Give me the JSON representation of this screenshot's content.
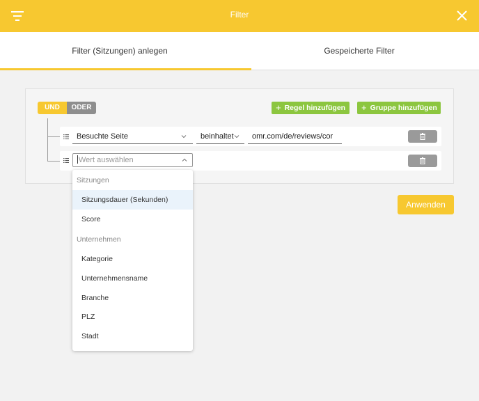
{
  "header": {
    "title": "Filter",
    "menu_icon": "filter-lines-icon",
    "close_icon": "close-icon"
  },
  "tabs": [
    {
      "label": "Filter (Sitzungen) anlegen",
      "active": true
    },
    {
      "label": "Gespeicherte Filter",
      "active": false
    }
  ],
  "logic": {
    "und_label": "UND",
    "oder_label": "ODER",
    "selected": "UND"
  },
  "actions": {
    "add_rule": "Regel hinzufügen",
    "add_group": "Gruppe hinzufügen",
    "apply": "Anwenden"
  },
  "rules": [
    {
      "field": "Besuchte Seite",
      "operator": "beinhaltet",
      "value": "omr.com/de/reviews/cor"
    },
    {
      "field_placeholder": "Wert auswählen"
    }
  ],
  "dropdown": {
    "groups": [
      {
        "label": "Sitzungen",
        "options": [
          "Sitzungsdauer (Sekunden)",
          "Score"
        ]
      },
      {
        "label": "Unternehmen",
        "options": [
          "Kategorie",
          "Unternehmensname",
          "Branche",
          "PLZ",
          "Stadt"
        ]
      }
    ],
    "highlighted": "Sitzungsdauer (Sekunden)"
  },
  "colors": {
    "accent": "#f7c830",
    "green": "#8cc63f",
    "gray": "#8e8e8e"
  }
}
